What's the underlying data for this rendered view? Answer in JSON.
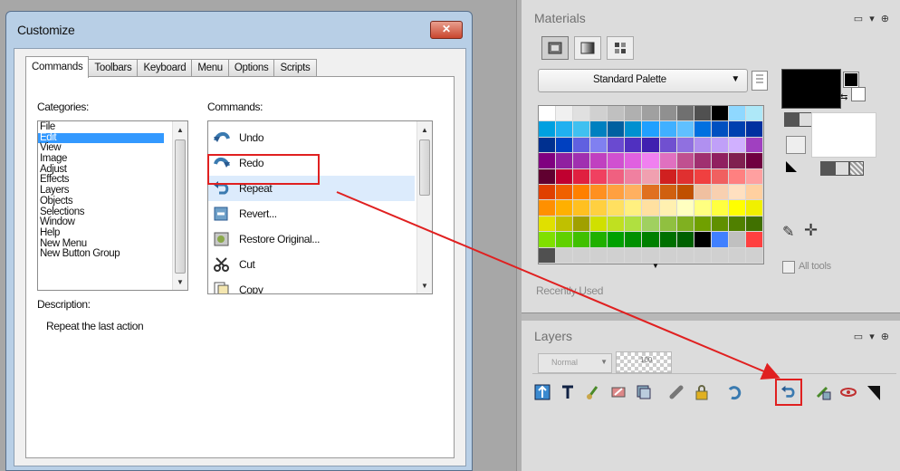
{
  "dialog": {
    "title": "Customize",
    "close_label": "✕",
    "tabs": [
      {
        "label": "Commands",
        "active": true
      },
      {
        "label": "Toolbars",
        "active": false
      },
      {
        "label": "Keyboard",
        "active": false
      },
      {
        "label": "Menu",
        "active": false
      },
      {
        "label": "Options",
        "active": false
      },
      {
        "label": "Scripts",
        "active": false
      }
    ],
    "categories_label": "Categories:",
    "categories": [
      "File",
      "Edit",
      "View",
      "Image",
      "Adjust",
      "Effects",
      "Layers",
      "Objects",
      "Selections",
      "Window",
      "Help",
      "New Menu",
      "New Button Group"
    ],
    "selected_category": "Edit",
    "commands_label": "Commands:",
    "commands": [
      {
        "label": "Undo",
        "icon": "undo-icon"
      },
      {
        "label": "Redo",
        "icon": "redo-icon"
      },
      {
        "label": "Repeat",
        "icon": "repeat-icon",
        "selected": true
      },
      {
        "label": "Revert...",
        "icon": "revert-icon"
      },
      {
        "label": "Restore Original...",
        "icon": "restore-original-icon"
      },
      {
        "label": "Cut",
        "icon": "scissors-icon"
      },
      {
        "label": "Copy",
        "icon": "copy-icon"
      }
    ],
    "description_label": "Description:",
    "description_text": "Repeat the last action"
  },
  "materials": {
    "title": "Materials",
    "controls": "▭ ▾ ⊕",
    "palette_select": "Standard Palette",
    "recently_used_label": "Recently Used",
    "all_tools_label": "All tools",
    "palette_colors": [
      [
        "#ffffff",
        "#f0f0f0",
        "#e0e0e0",
        "#d0d0d0",
        "#c0c0c0",
        "#b0b0b0",
        "#a0a0a0",
        "#909090",
        "#707070",
        "#505050",
        "#000000",
        "#8fd8ff",
        "#aee8f8"
      ],
      [
        "#00a0e0",
        "#20b0f0",
        "#40c0f0",
        "#0080c0",
        "#0060a0",
        "#0090d0",
        "#20a0ff",
        "#40b0ff",
        "#60c0ff",
        "#0070e0",
        "#0050c0",
        "#0040b0",
        "#0030a0"
      ],
      [
        "#003090",
        "#0040c0",
        "#6060e0",
        "#8080f0",
        "#6a4ad0",
        "#5030c0",
        "#4020b0",
        "#7050d0",
        "#9070e0",
        "#b090f0",
        "#c0a0f8",
        "#d0b0ff",
        "#a040c0"
      ],
      [
        "#800080",
        "#9020a0",
        "#a030b0",
        "#c040c0",
        "#d050d0",
        "#e060e0",
        "#f080f0",
        "#e070c0",
        "#c05090",
        "#a03070",
        "#902060",
        "#802050",
        "#700040"
      ],
      [
        "#600030",
        "#c00030",
        "#e02040",
        "#f04060",
        "#f06080",
        "#f080a0",
        "#f0a0b0",
        "#d02020",
        "#e03030",
        "#f04040",
        "#f06060",
        "#ff8080",
        "#ffa0a0"
      ],
      [
        "#e04000",
        "#f06000",
        "#ff8000",
        "#ff9020",
        "#ffa040",
        "#ffb060",
        "#e07020",
        "#d06010",
        "#c05000",
        "#f0c0a0",
        "#f8d0b0",
        "#ffe0c0",
        "#ffd0a0"
      ],
      [
        "#ff9000",
        "#ffb000",
        "#ffc020",
        "#ffd040",
        "#ffe060",
        "#fff080",
        "#ffe0a0",
        "#fff0b0",
        "#ffffc0",
        "#ffff80",
        "#ffff40",
        "#ffff00",
        "#f0f000"
      ],
      [
        "#e0e000",
        "#c0c000",
        "#a0a000",
        "#d0e000",
        "#c0e020",
        "#b0e040",
        "#a0d060",
        "#90c040",
        "#80b020",
        "#70a000",
        "#609000",
        "#508000",
        "#407000"
      ],
      [
        "#80e000",
        "#60d000",
        "#40c000",
        "#20b000",
        "#00a000",
        "#009000",
        "#008000",
        "#007000",
        "#006000",
        "#000000",
        "#4080ff",
        "#c0c0c0",
        "#ff4040"
      ],
      [
        "#505050",
        "#d0d0d0",
        "#d0d0d0",
        "#d0d0d0",
        "#d0d0d0",
        "#d0d0d0",
        "#d0d0d0",
        "#d0d0d0",
        "#d0d0d0",
        "#d0d0d0",
        "#d0d0d0",
        "#d0d0d0",
        "#d0d0d0"
      ]
    ]
  },
  "layers": {
    "title": "Layers",
    "controls": "▭ ▾ ⊕",
    "blend_mode": "Normal",
    "opacity": "100"
  },
  "colors": {
    "accent_red": "#e02020",
    "selection_blue": "#3399ff"
  }
}
